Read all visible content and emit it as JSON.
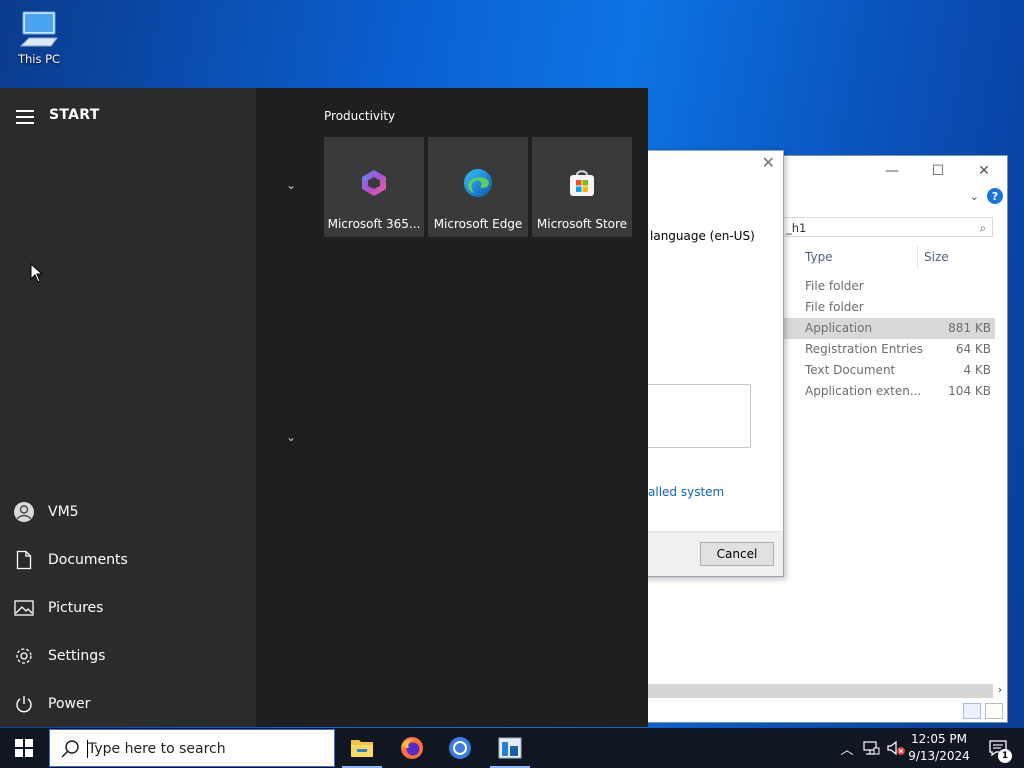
{
  "desktop": {
    "icon_label": "This PC"
  },
  "explorer": {
    "minimize": "—",
    "maximize": "☐",
    "close": "✕",
    "search_value": "_h1",
    "columns": {
      "type": "Type",
      "size": "Size"
    },
    "rows": [
      {
        "type": "File folder",
        "size": ""
      },
      {
        "type": "File folder",
        "size": ""
      },
      {
        "type": "Application",
        "size": "881 KB",
        "selected": true
      },
      {
        "type": "Registration Entries",
        "size": "64 KB"
      },
      {
        "type": "Text Document",
        "size": "4 KB"
      },
      {
        "type": "Application exten...",
        "size": "104 KB"
      }
    ]
  },
  "dialog": {
    "close": "✕",
    "language_text": "language (en-US)",
    "link_text": "alled system",
    "cancel_label": "Cancel"
  },
  "start_menu": {
    "title": "START",
    "user": "VM5",
    "nav": [
      {
        "label": "Documents",
        "icon": "document-icon"
      },
      {
        "label": "Pictures",
        "icon": "pictures-icon"
      },
      {
        "label": "Settings",
        "icon": "gear-icon"
      },
      {
        "label": "Power",
        "icon": "power-icon"
      }
    ],
    "group_label": "Productivity",
    "tiles": [
      {
        "label": "Microsoft 365...",
        "icon": "microsoft-365-icon"
      },
      {
        "label": "Microsoft Edge",
        "icon": "edge-icon"
      },
      {
        "label": "Microsoft Store",
        "icon": "store-icon"
      }
    ]
  },
  "taskbar": {
    "search_placeholder": "Type here to search",
    "apps": [
      "file-explorer-icon",
      "firefox-icon",
      "chrome-icon",
      "installer-icon"
    ],
    "time": "12:05 PM",
    "date": "9/13/2024",
    "notification_count": "1"
  },
  "colors": {
    "accent": "#0b5fd0",
    "start_bg": "#1f1f1f",
    "taskbar_bg": "#101722"
  }
}
